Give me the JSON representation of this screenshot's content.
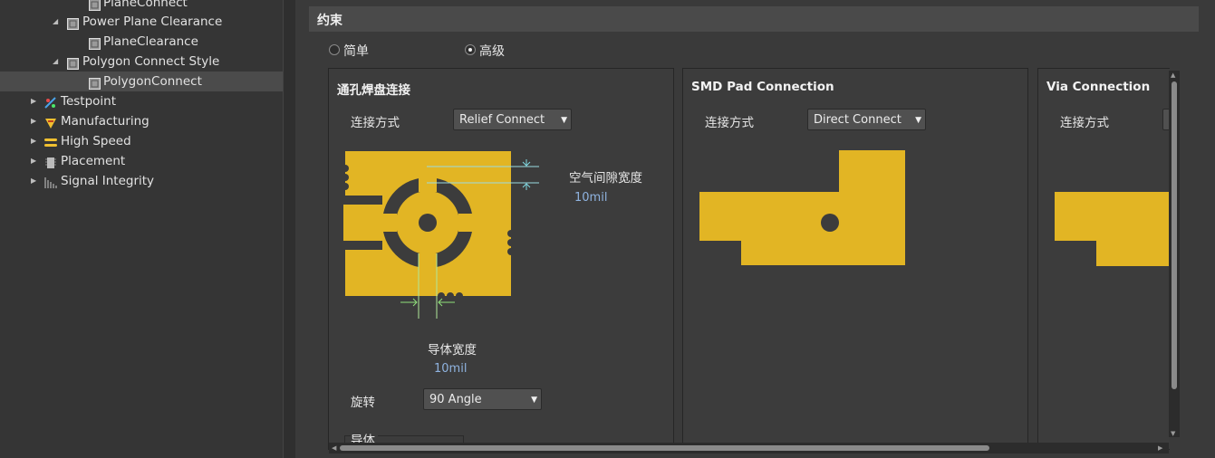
{
  "tree": {
    "items": [
      {
        "label": "PlaneConnect",
        "icon": "rule-icon"
      },
      {
        "label": "Power Plane Clearance",
        "icon": "rule-group-icon",
        "expanded": true
      },
      {
        "label": "PlaneClearance",
        "icon": "rule-icon"
      },
      {
        "label": "Polygon Connect Style",
        "icon": "rule-group-icon",
        "expanded": true
      },
      {
        "label": "PolygonConnect",
        "icon": "rule-icon",
        "selected": true
      },
      {
        "label": "Testpoint",
        "icon": "testpoint-icon",
        "expanded": false
      },
      {
        "label": "Manufacturing",
        "icon": "manufacturing-icon",
        "expanded": false
      },
      {
        "label": "High Speed",
        "icon": "high-speed-icon",
        "expanded": false
      },
      {
        "label": "Placement",
        "icon": "placement-icon",
        "expanded": false
      },
      {
        "label": "Signal Integrity",
        "icon": "signal-integrity-icon",
        "expanded": false
      }
    ]
  },
  "constraints": {
    "header": "约束",
    "mode_simple": "简单",
    "mode_advanced": "高级",
    "selected_mode": "advanced"
  },
  "through_hole": {
    "title": "通孔焊盘连接",
    "connect_label": "连接方式",
    "connect_value": "Relief Connect",
    "air_gap_label": "空气间隙宽度",
    "air_gap_value": "10mil",
    "conductor_width_label": "导体宽度",
    "conductor_width_value": "10mil",
    "rotation_label": "旋转",
    "rotation_value": "90 Angle",
    "conductors_label": "导体"
  },
  "smd": {
    "title": "SMD Pad Connection",
    "connect_label": "连接方式",
    "connect_value": "Direct Connect"
  },
  "via": {
    "title": "Via Connection",
    "connect_label": "连接方式"
  },
  "colors": {
    "copper": "#e2b524",
    "background": "#3c3c3c",
    "value_text": "#8fb3e0",
    "dimension_cyan": "#7fd7e0",
    "dimension_green": "#8fe07a"
  }
}
